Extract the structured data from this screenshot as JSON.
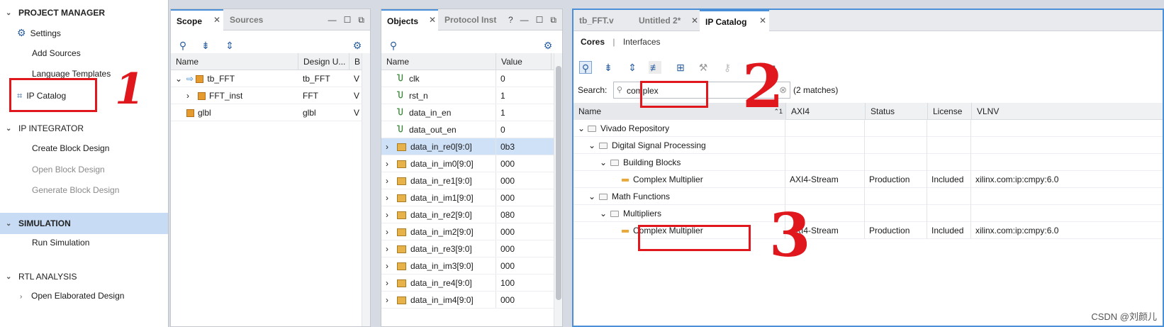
{
  "flow_navigator": {
    "project_manager": {
      "heading": "PROJECT MANAGER",
      "items": [
        "Settings",
        "Add Sources",
        "Language Templates",
        "IP Catalog"
      ]
    },
    "ip_integrator": {
      "heading": "IP INTEGRATOR",
      "items": [
        "Create Block Design",
        "Open Block Design",
        "Generate Block Design"
      ]
    },
    "simulation": {
      "heading": "SIMULATION",
      "items": [
        "Run Simulation"
      ]
    },
    "rtl_analysis": {
      "heading": "RTL ANALYSIS",
      "items": [
        "Open Elaborated Design"
      ]
    }
  },
  "scope_panel": {
    "tabs": [
      "Scope",
      "Sources"
    ],
    "columns": [
      "Name",
      "Design U...",
      "B"
    ],
    "rows": [
      {
        "name": "tb_FFT",
        "design_unit": "tb_FFT",
        "b": "V"
      },
      {
        "name": "FFT_inst",
        "design_unit": "FFT",
        "b": "V"
      },
      {
        "name": "glbl",
        "design_unit": "glbl",
        "b": "V"
      }
    ]
  },
  "objects_panel": {
    "tabs": [
      "Objects",
      "Protocol Inst"
    ],
    "columns": [
      "Name",
      "Value"
    ],
    "rows": [
      {
        "name": "clk",
        "value": "0"
      },
      {
        "name": "rst_n",
        "value": "1"
      },
      {
        "name": "data_in_en",
        "value": "1"
      },
      {
        "name": "data_out_en",
        "value": "0"
      },
      {
        "name": "data_in_re0[9:0]",
        "value": "0b3"
      },
      {
        "name": "data_in_im0[9:0]",
        "value": "000"
      },
      {
        "name": "data_in_re1[9:0]",
        "value": "000"
      },
      {
        "name": "data_in_im1[9:0]",
        "value": "000"
      },
      {
        "name": "data_in_re2[9:0]",
        "value": "080"
      },
      {
        "name": "data_in_im2[9:0]",
        "value": "000"
      },
      {
        "name": "data_in_re3[9:0]",
        "value": "000"
      },
      {
        "name": "data_in_im3[9:0]",
        "value": "000"
      },
      {
        "name": "data_in_re4[9:0]",
        "value": "100"
      },
      {
        "name": "data_in_im4[9:0]",
        "value": "000"
      }
    ]
  },
  "ip_catalog_panel": {
    "tabs": [
      "tb_FFT.v",
      "Untitled 2*",
      "IP Catalog"
    ],
    "subtabs": [
      "Cores",
      "Interfaces"
    ],
    "search_label": "Search:",
    "search_value": "complex",
    "matches": "(2 matches)",
    "columns": [
      "Name",
      "AXI4",
      "Status",
      "License",
      "VLNV"
    ],
    "tree": [
      {
        "label": "Vivado Repository"
      },
      {
        "label": "Digital Signal Processing"
      },
      {
        "label": "Building Blocks"
      },
      {
        "label": "Complex Multiplier",
        "axi4": "AXI4-Stream",
        "status": "Production",
        "license": "Included",
        "vlnv": "xilinx.com:ip:cmpy:6.0"
      },
      {
        "label": "Math Functions"
      },
      {
        "label": "Multipliers"
      },
      {
        "label": "Complex Multiplier",
        "axi4": "AXI4-Stream",
        "status": "Production",
        "license": "Included",
        "vlnv": "xilinx.com:ip:cmpy:6.0"
      }
    ]
  },
  "annotations": [
    "1",
    "2",
    "3"
  ],
  "watermark": "CSDN @刘颜儿"
}
